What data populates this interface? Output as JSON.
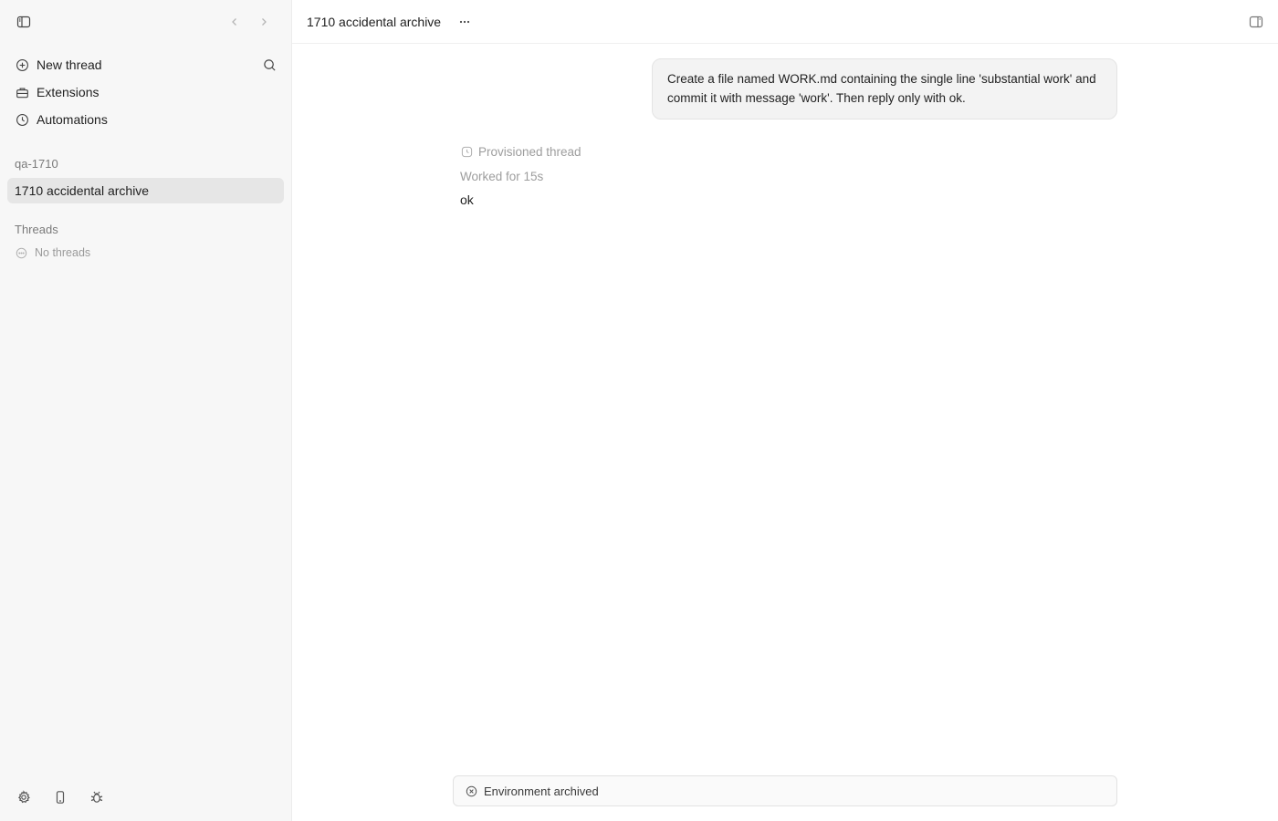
{
  "sidebar": {
    "menu": [
      {
        "label": "New thread",
        "icon": "plus-circle-icon"
      },
      {
        "label": "Extensions",
        "icon": "toolbox-icon"
      },
      {
        "label": "Automations",
        "icon": "clock-icon"
      }
    ],
    "project_name": "qa-1710",
    "active_thread": "1710 accidental archive",
    "threads_heading": "Threads",
    "no_threads_label": "No threads"
  },
  "header": {
    "title": "1710 accidental archive"
  },
  "conversation": {
    "user_message": "Create a file named WORK.md containing the single line 'substantial work' and commit it with message 'work'. Then reply only with ok.",
    "provisioned_label": "Provisioned thread",
    "worked_label": "Worked for 15s",
    "assistant_reply": "ok"
  },
  "status": {
    "text": "Environment archived"
  },
  "colors": {
    "sidebar_bg": "#f7f7f7",
    "active_item_bg": "#e6e6e6",
    "muted_text": "#9d9d9d",
    "bubble_bg": "#f3f3f3"
  }
}
